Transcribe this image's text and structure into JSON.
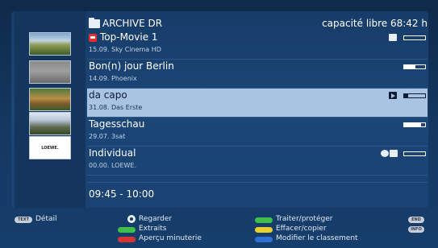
{
  "header": {
    "title": "ARCHIVE DR",
    "free_space": "capacité libre 68:42 h"
  },
  "recordings": [
    {
      "title": "Top-Movie 1",
      "date_channel": "15.09.  Sky Cinema HD",
      "progress": 0.0,
      "locked": true,
      "icon": "key-icon"
    },
    {
      "title": "Bon(n) jour Berlin",
      "date_channel": "14.09.  Phoenix",
      "progress": 0.55
    },
    {
      "title": "da capo",
      "date_channel": "31.08.  Das Erste",
      "progress": 0.2,
      "selected": true,
      "icon": "play-icon"
    },
    {
      "title": "Tagesschau",
      "date_channel": "29.07.  3sat",
      "progress": 0.8
    },
    {
      "title": "Individual",
      "date_channel": "00.00.  LOEWE.",
      "progress": 0.0,
      "icon": "timer-camera-icon"
    }
  ],
  "thumbnails": {
    "loewe_logo": "LOEWE."
  },
  "time_range": "09:45 - 10:00",
  "footer": {
    "text_key": "TEXT",
    "detail": "Détail",
    "ok_action": "Regarder",
    "green_action": "Extraits",
    "red_action": "Aperçu minuterie",
    "green2_action": "Traiter/protéger",
    "yellow_action": "Effacer/copier",
    "blue_action": "Modifier le classement",
    "end_key": "END",
    "info_key": "INFO"
  },
  "colors": {
    "selected_row": "#a9c3e3",
    "red": "#d83232",
    "green": "#3fbf4a",
    "yellow": "#e6cf2f",
    "blue": "#2f6fd6"
  }
}
